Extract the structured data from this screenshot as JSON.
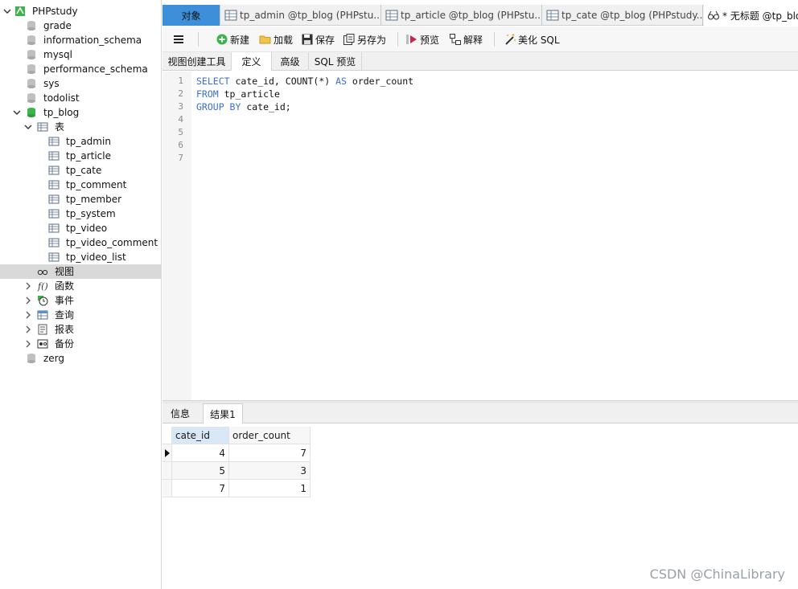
{
  "sidebar": {
    "connection": "PHPstudy",
    "databases": [
      "grade",
      "information_schema",
      "mysql",
      "performance_schema",
      "sys",
      "todolist"
    ],
    "open_db": "tp_blog",
    "tables_label": "表",
    "tables": [
      "tp_admin",
      "tp_article",
      "tp_cate",
      "tp_comment",
      "tp_member",
      "tp_system",
      "tp_video",
      "tp_video_comment",
      "tp_video_list"
    ],
    "folders": [
      "视图",
      "函数",
      "事件",
      "查询",
      "报表",
      "备份"
    ],
    "last_db": "zerg"
  },
  "tabs": [
    {
      "label": "对象"
    },
    {
      "label": "tp_admin @tp_blog (PHPstu..."
    },
    {
      "label": "tp_article @tp_blog (PHPstu..."
    },
    {
      "label": "tp_cate @tp_blog (PHPstudy..."
    },
    {
      "label": "* 无标题 @tp_blo"
    }
  ],
  "toolbar": {
    "new": "新建",
    "load": "加载",
    "save": "保存",
    "save_as": "另存为",
    "preview": "预览",
    "explain": "解释",
    "beautify": "美化 SQL"
  },
  "subtabs": [
    "视图创建工具",
    "定义",
    "高级",
    "SQL 预览"
  ],
  "editor": {
    "line_numbers": [
      "1",
      "2",
      "3",
      "4",
      "5",
      "6",
      "7"
    ],
    "lines": [
      [
        {
          "t": "SELECT",
          "k": true
        },
        {
          "t": " cate_id, COUNT(*) ",
          "k": false
        },
        {
          "t": "AS",
          "k": true
        },
        {
          "t": " order_count",
          "k": false
        }
      ],
      [
        {
          "t": "FROM",
          "k": true
        },
        {
          "t": " tp_article",
          "k": false
        }
      ],
      [
        {
          "t": "GROUP BY",
          "k": true
        },
        {
          "t": " cate_id;",
          "k": false
        }
      ]
    ]
  },
  "result_tabs": [
    "信息",
    "结果1"
  ],
  "result": {
    "columns": [
      "cate_id",
      "order_count"
    ],
    "rows": [
      [
        "4",
        "7"
      ],
      [
        "5",
        "3"
      ],
      [
        "7",
        "1"
      ]
    ]
  },
  "watermark": "CSDN @ChinaLibrary",
  "colors": {
    "tab_accent": "#3d8fd9",
    "keyword": "#3a6fcf",
    "db_green": "#3bb54a"
  }
}
